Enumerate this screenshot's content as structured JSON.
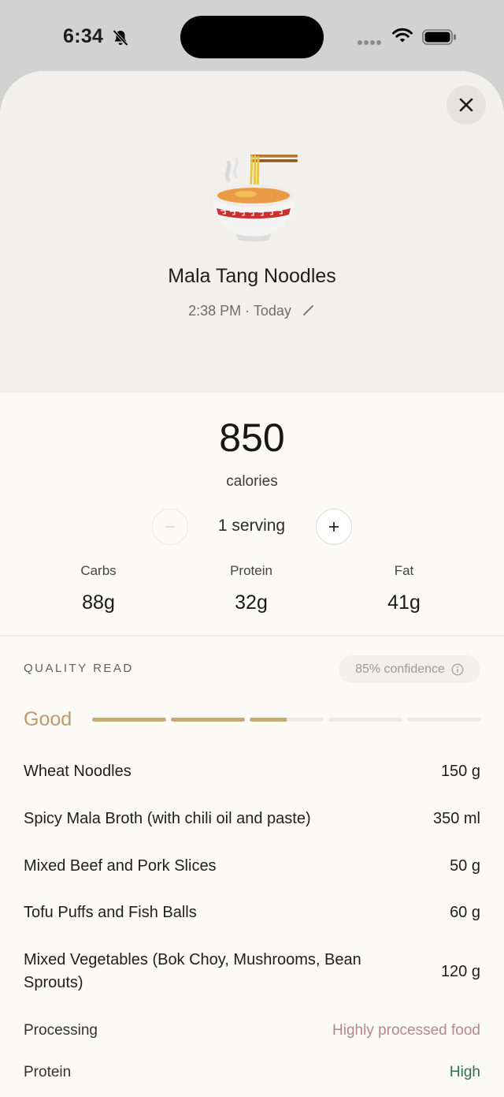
{
  "status_bar": {
    "time": "6:34"
  },
  "food": {
    "name": "Mala Tang Noodles",
    "time": "2:38 PM",
    "day": "Today",
    "icon": "ramen-bowl-icon"
  },
  "nutrition": {
    "calories": "850",
    "calories_label": "calories",
    "serving": "1 serving",
    "macros": [
      {
        "label": "Carbs",
        "value": "88g"
      },
      {
        "label": "Protein",
        "value": "32g"
      },
      {
        "label": "Fat",
        "value": "41g"
      }
    ]
  },
  "quality": {
    "title": "QUALITY READ",
    "confidence": "85% confidence",
    "grade": "Good",
    "level": 0.5,
    "colors": {
      "accent": "#c9a878",
      "empty": "#f0ebe2"
    }
  },
  "ingredients": [
    {
      "name": "Wheat Noodles",
      "amount": "150 g"
    },
    {
      "name": "Spicy Mala Broth (with chili oil and paste)",
      "amount": "350 ml"
    },
    {
      "name": "Mixed Beef and Pork Slices",
      "amount": "50 g"
    },
    {
      "name": "Tofu Puffs and Fish Balls",
      "amount": "60 g"
    },
    {
      "name": "Mixed Vegetables (Bok Choy, Mushrooms, Bean Sprouts)",
      "amount": "120 g"
    }
  ],
  "attributes": [
    {
      "label": "Processing",
      "value": "Highly processed food",
      "color": "#b9868a"
    },
    {
      "label": "Protein",
      "value": "High",
      "color": "#2f6e52"
    }
  ]
}
